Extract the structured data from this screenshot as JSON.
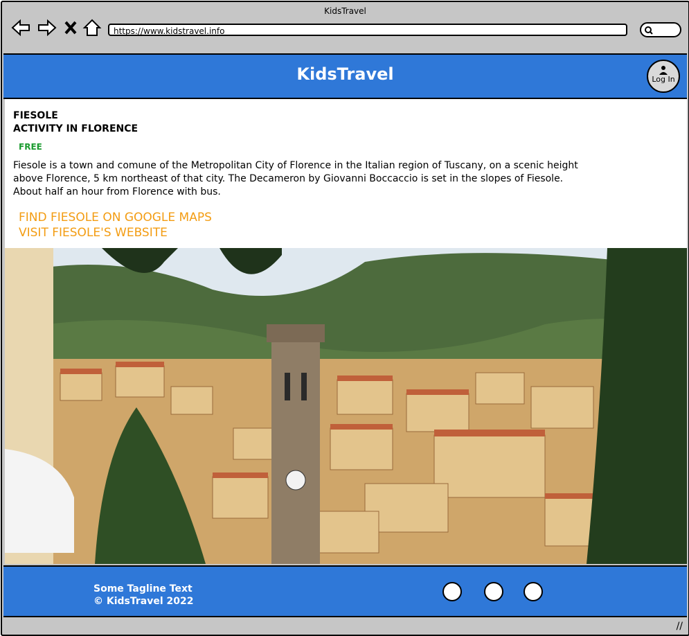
{
  "window": {
    "title": "KidsTravel"
  },
  "browser": {
    "url": "https://www.kidstravel.info",
    "icons": [
      "back-arrow-icon",
      "forward-arrow-icon",
      "close-x-icon",
      "home-icon",
      "search-icon"
    ]
  },
  "header": {
    "brand": "KidsTravel",
    "login_label": "Log In",
    "color": "#2f78d8"
  },
  "activity": {
    "name": "FIESOLE",
    "subtitle": "ACTIVITY IN FLORENCE",
    "price": "FREE",
    "description": "Fiesole is a town and comune of the Metropolitan City of Florence in the Italian region of Tuscany, on a scenic height above Florence, 5 km northeast of that city. The Decameron by Giovanni Boccaccio is set in the slopes of Fiesole. About half an hour from Florence with bus.",
    "links": {
      "maps": "FIND FIESOLE ON GOOGLE MAPS",
      "website": "VISIT FIESOLE'S WEBSITE"
    },
    "link_color": "#f39c12",
    "price_color": "#1a9b2f"
  },
  "footer": {
    "tagline": "Some Tagline Text",
    "copyright": "© KidsTravel 2022",
    "social_icons": [
      "social-icon-1",
      "social-icon-2",
      "social-icon-3"
    ]
  }
}
